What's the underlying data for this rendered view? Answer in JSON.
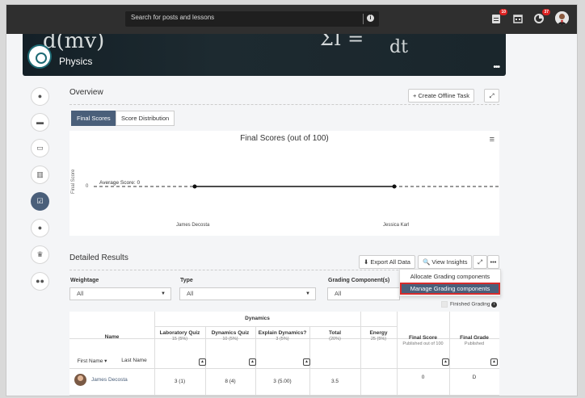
{
  "search": {
    "placeholder": "Search for posts and lessons"
  },
  "topbar": {
    "icons": [
      {
        "name": "calendar-page-icon",
        "badge": "10"
      },
      {
        "name": "calendar-icon",
        "badge": ""
      },
      {
        "name": "notifications-icon",
        "badge": "37"
      }
    ]
  },
  "banner": {
    "course": "Physics",
    "eq1": "d(mv)",
    "eq2": "ΣI =",
    "eq3": "dt",
    "more": "•••"
  },
  "sidebar": [
    {
      "name": "sidebar-comments-icon",
      "glyph": "●"
    },
    {
      "name": "sidebar-folder-icon",
      "glyph": "▬"
    },
    {
      "name": "sidebar-card-icon",
      "glyph": "▭"
    },
    {
      "name": "sidebar-chart-icon",
      "glyph": "▥"
    },
    {
      "name": "sidebar-grades-icon",
      "glyph": "☑"
    },
    {
      "name": "sidebar-person-icon",
      "glyph": "●"
    },
    {
      "name": "sidebar-trophy-icon",
      "glyph": "♛"
    },
    {
      "name": "sidebar-group-icon",
      "glyph": "●●"
    }
  ],
  "overview": {
    "title": "Overview",
    "create_task": "+ Create Offline Task",
    "expand": "⤢",
    "tabs": [
      "Final Scores",
      "Score Distribution"
    ]
  },
  "chart_data": {
    "type": "line",
    "title": "Final Scores (out of 100)",
    "categories": [
      "James Decosta",
      "Jessica Karl"
    ],
    "series": [
      {
        "values": [
          0,
          0
        ]
      }
    ],
    "ylabel": "Final Score",
    "yticks": [
      "0"
    ],
    "annotations": [
      "Average Score: 0"
    ],
    "menu": "≡",
    "legend": "none"
  },
  "detailed": {
    "title": "Detailed Results",
    "export": "⬇ Export All Data",
    "insights": "🔍 View Insights",
    "expand": "⤢",
    "more": "•••",
    "weightage_label": "Weightage",
    "weightage_value": "All",
    "type_label": "Type",
    "type_value": "All",
    "grading_label": "Grading Component(s)",
    "grading_value": "All",
    "menu": [
      "Allocate Grading components",
      "Manage Grading components"
    ],
    "finished": "Finished Grading"
  },
  "table": {
    "group": "Dynamics",
    "name_header": "Name",
    "first_name": "First Name ▾",
    "last_name": "Last Name",
    "columns": [
      {
        "title": "Laboratory Quiz",
        "sub": "15 (5%)"
      },
      {
        "title": "Dynamics Quiz",
        "sub": "10 (5%)"
      },
      {
        "title": "Explain Dynamics?",
        "sub": "3 (5%)"
      },
      {
        "title": "Total",
        "sub": "(20%)"
      },
      {
        "title": "Energy",
        "sub": "25 (5%)"
      },
      {
        "title": "Final Score",
        "sub": "Published out of 100"
      },
      {
        "title": "Final Grade",
        "sub": "Published"
      }
    ],
    "row": {
      "name": "James Decosta",
      "values": [
        "3 (1)",
        "8 (4)",
        "3 (5.00)",
        "3.5",
        "",
        "0",
        "D"
      ]
    }
  }
}
